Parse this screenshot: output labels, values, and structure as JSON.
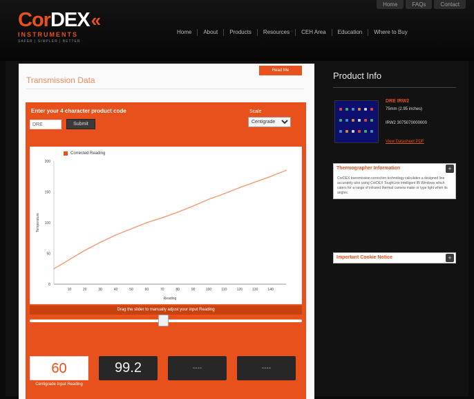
{
  "utility_nav": [
    "Home",
    "FAQs",
    "Contact"
  ],
  "brand": {
    "cor": "Cor",
    "dex": "DEX",
    "chevrons": "«",
    "subtitle": "INSTRUMENTS",
    "tagline": "SAFER | SIMPLER | BETTER"
  },
  "main_nav": [
    "Home",
    "About",
    "Products",
    "Resources",
    "CEH Area",
    "Education",
    "Where to Buy"
  ],
  "content": {
    "title": "Transmission Data",
    "tab_button": "Read Me",
    "prompt": "Enter your 4 character product code",
    "code_value": "DRE",
    "submit_label": "Submit",
    "unit_label": "Scale",
    "unit_selected": "Centigrade",
    "slider_title": "Drag the slider to manually adjust your input Reading",
    "values": [
      {
        "value": "60",
        "label": "Centigrade Input Reading"
      },
      {
        "value": "99.2",
        "label": "—"
      },
      {
        "value": "----",
        "label": "—"
      },
      {
        "value": "----",
        "label": "—"
      }
    ]
  },
  "chart_data": {
    "type": "line",
    "legend": "Corrected Reading",
    "xlabel": "Reading",
    "ylabel": "Temperature",
    "x": [
      0,
      10,
      20,
      30,
      40,
      50,
      60,
      70,
      80,
      90,
      100,
      110,
      120,
      130,
      140,
      150
    ],
    "series": [
      {
        "name": "Corrected Reading",
        "values": [
          25,
          40,
          55,
          68,
          80,
          90,
          100,
          108,
          117,
          127,
          138,
          147,
          157,
          166,
          175,
          185
        ]
      }
    ],
    "xticks": [
      "10",
      "20",
      "30",
      "40",
      "50",
      "60",
      "70",
      "80",
      "90",
      "100",
      "110",
      "120",
      "130",
      "140"
    ],
    "ylim": [
      0,
      200
    ],
    "yticks": [
      "0",
      "50",
      "100",
      "150",
      "200"
    ],
    "line_color": "#f4a07a"
  },
  "sidebar": {
    "title": "Product Info",
    "product_name": "DRE IRW2",
    "product_desc": "75mm (2.95 inches)",
    "product_part": "IRW2 3075070000000",
    "product_link": "View Datasheet PDF",
    "thermo_title": "Thermographer Information",
    "thermo_body": "CorDEX transmission correction technology calculates a designed line accurately also using CorDEX ToughLine intelligent IR Windows which caters for a range of infrared thermal camera make or type light when its angles.",
    "notice_title": "Important Cookie Notice",
    "toggle_label": "+"
  },
  "colors": {
    "accent": "#e8501c",
    "background": "#0b0b0b",
    "panel": "#fafafa"
  }
}
